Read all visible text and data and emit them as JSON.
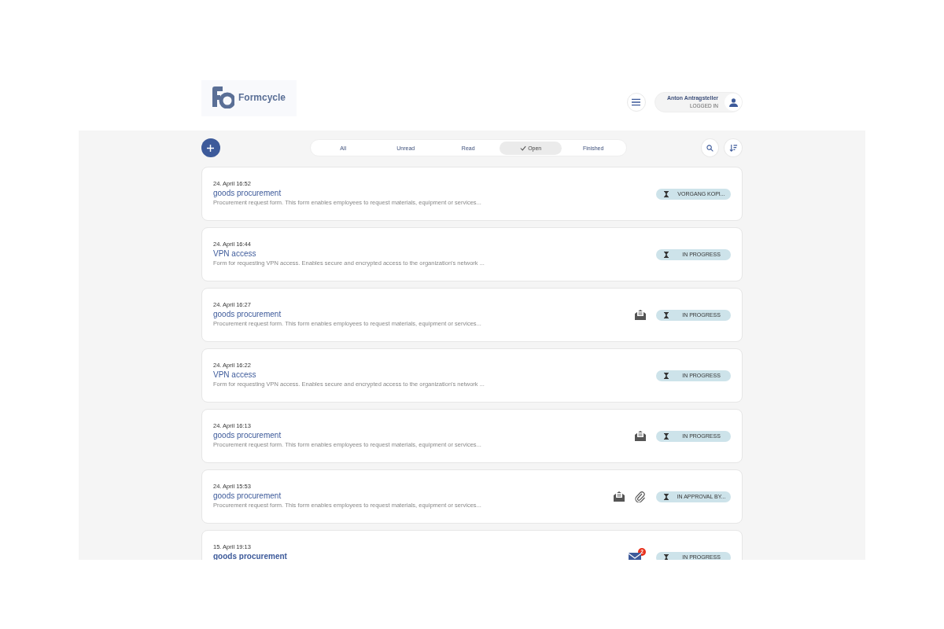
{
  "header": {
    "logo": "Formcycle",
    "user": {
      "name": "Anton Antragsteller",
      "status": "LOGGED IN"
    }
  },
  "filters": [
    {
      "label": "All",
      "selected": false
    },
    {
      "label": "Unread",
      "selected": false
    },
    {
      "label": "Read",
      "selected": false
    },
    {
      "label": "Open",
      "selected": true
    },
    {
      "label": "Finished",
      "selected": false
    }
  ],
  "items": [
    {
      "date": "24. April 16:52",
      "title": "goods procurement",
      "description": "Procurement request form. This form enables employees to request materials, equipment or services...",
      "unread": false,
      "status": "VORGANG KOPI..."
    },
    {
      "date": "24. April 16:44",
      "title": "VPN access",
      "description": "Form for requesting VPN access. Enables secure and encrypted access to the organization's network ...",
      "unread": false,
      "status": "IN PROGRESS"
    },
    {
      "date": "24. April 16:27",
      "title": "goods procurement",
      "description": "Procurement request form. This form enables employees to request materials, equipment or services...",
      "unread": false,
      "icons": [
        {
          "kind": "opened-mail"
        }
      ],
      "status": "IN PROGRESS"
    },
    {
      "date": "24. April 16:22",
      "title": "VPN access",
      "description": "Form for requesting VPN access. Enables secure and encrypted access to the organization's network ...",
      "unread": false,
      "status": "IN PROGRESS"
    },
    {
      "date": "24. April 16:13",
      "title": "goods procurement",
      "description": "Procurement request form. This form enables employees to request materials, equipment or services...",
      "unread": false,
      "icons": [
        {
          "kind": "opened-mail"
        }
      ],
      "status": "IN PROGRESS"
    },
    {
      "date": "24. April 15:53",
      "title": "goods procurement",
      "description": "Procurement request form. This form enables employees to request materials, equipment or services...",
      "unread": false,
      "icons": [
        {
          "kind": "opened-mail"
        },
        {
          "kind": "attachment"
        }
      ],
      "status": "IN APPROVAL BY..."
    },
    {
      "date": "15. April 19:13",
      "title": "goods procurement",
      "unread": true,
      "icons": [
        {
          "kind": "unread-mail",
          "count": "2"
        }
      ],
      "status": "IN PROGRESS"
    }
  ]
}
